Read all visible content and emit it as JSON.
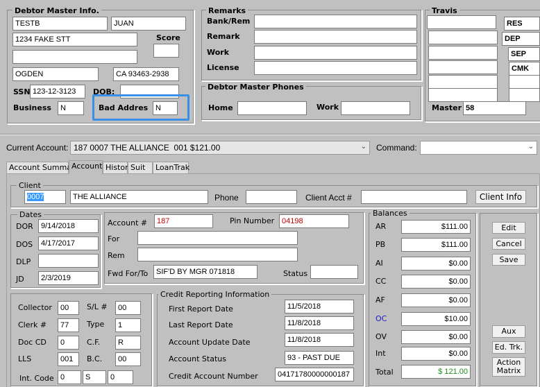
{
  "debtor_master": {
    "title": "Debtor Master Info.",
    "last_name": "TESTB",
    "first_name": "JUAN",
    "address1": "1234 FAKE STT",
    "address2": "",
    "city": "OGDEN",
    "state_zip": "CA 93463-2938",
    "score_label": "Score",
    "score": "",
    "ssn_label": "SSN",
    "ssn": "123-12-3123",
    "dob_label": "DOB:",
    "dob": "",
    "business_label": "Business",
    "business": "N",
    "bad_address_label": "Bad Addres",
    "bad_address": "N"
  },
  "remarks": {
    "title": "Remarks",
    "bank_rem_label": "Bank/Rem",
    "remark_label": "Remark",
    "work_label": "Work",
    "license_label": "License",
    "bank_rem": "",
    "remark": "",
    "work": "",
    "license": ""
  },
  "phones": {
    "title": "Debtor Master Phones",
    "home_label": "Home",
    "work_label": "Work",
    "home": "",
    "work": ""
  },
  "travis": {
    "title": "Travis",
    "codes": [
      "RES",
      "DEP",
      "SEP",
      "CMK"
    ],
    "master_label": "Master",
    "master": "58"
  },
  "current_account": {
    "label": "Current Account:",
    "value": "187 0007 THE ALLIANCE  001 $121.00",
    "command_label": "Command:",
    "command": ""
  },
  "tabs": [
    "Account Summary",
    "Account",
    "History",
    "Suit",
    "LoanTrak"
  ],
  "client": {
    "title": "Client",
    "code": "0007",
    "name": "THE ALLIANCE",
    "phone_label": "Phone",
    "phone": "",
    "acct_label": "Client Acct #",
    "acct": "",
    "info_button": "Client Info"
  },
  "dates": {
    "title": "Dates",
    "dor_label": "DOR",
    "dor": "9/14/2018",
    "dos_label": "DOS",
    "dos": "4/17/2017",
    "dlp_label": "DLP",
    "dlp": "",
    "jd_label": "JD",
    "jd": "2/3/2019"
  },
  "account": {
    "acct_label": "Account #",
    "acct": "187",
    "pin_label": "Pin Number",
    "pin": "04198",
    "for_label": "For",
    "for": "",
    "rem_label": "Rem",
    "rem": "",
    "fwd_label": "Fwd For/To",
    "fwd": "SIF'D BY MGR 071818",
    "status_label": "Status",
    "status": ""
  },
  "misc": {
    "collector_label": "Collector",
    "collector": "00",
    "sl_label": "S/L #",
    "sl": "00",
    "clerk_label": "Clerk #",
    "clerk": "77",
    "type_label": "Type",
    "type": "1",
    "doccd_label": "Doc CD",
    "doccd": "0",
    "cf_label": "C.F.",
    "cf": "R",
    "lls_label": "LLS",
    "lls": "001",
    "bc_label": "B.C.",
    "bc": "00",
    "intcode_label": "Int. Code",
    "int1": "0",
    "int2": "S",
    "int3": "0"
  },
  "credit": {
    "title": "Credit Reporting Information",
    "first_label": "First Report Date",
    "first": "11/5/2018",
    "last_label": "Last Report Date",
    "last": "11/8/2018",
    "update_label": "Account Update Date",
    "update": "11/8/2018",
    "status_label": "Account Status",
    "status": "93 - PAST DUE",
    "number_label": "Credit Account Number",
    "number": "04171780000000187"
  },
  "balances": {
    "title": "Balances",
    "ar_label": "AR",
    "ar": "$111.00",
    "pb_label": "PB",
    "pb": "$111.00",
    "ai_label": "AI",
    "ai": "$0.00",
    "cc_label": "CC",
    "cc": "$0.00",
    "af_label": "AF",
    "af": "$0.00",
    "oc_label": "OC",
    "oc": "$10.00",
    "ov_label": "OV",
    "ov": "$0.00",
    "int_label": "Int",
    "int": "$0.00",
    "total_label": "Total",
    "total": "$ 121.00"
  },
  "actions": {
    "edit": "Edit",
    "cancel": "Cancel",
    "save": "Save",
    "aux": "Aux",
    "ed_trk": "Ed. Trk.",
    "action_matrix_1": "Action",
    "action_matrix_2": "Matrix"
  },
  "colors": {
    "highlight_box": "#3a8ee6",
    "red_value": "#c00000",
    "total_green": "#1a8a1a",
    "oc_blue": "#1a1ad0"
  }
}
